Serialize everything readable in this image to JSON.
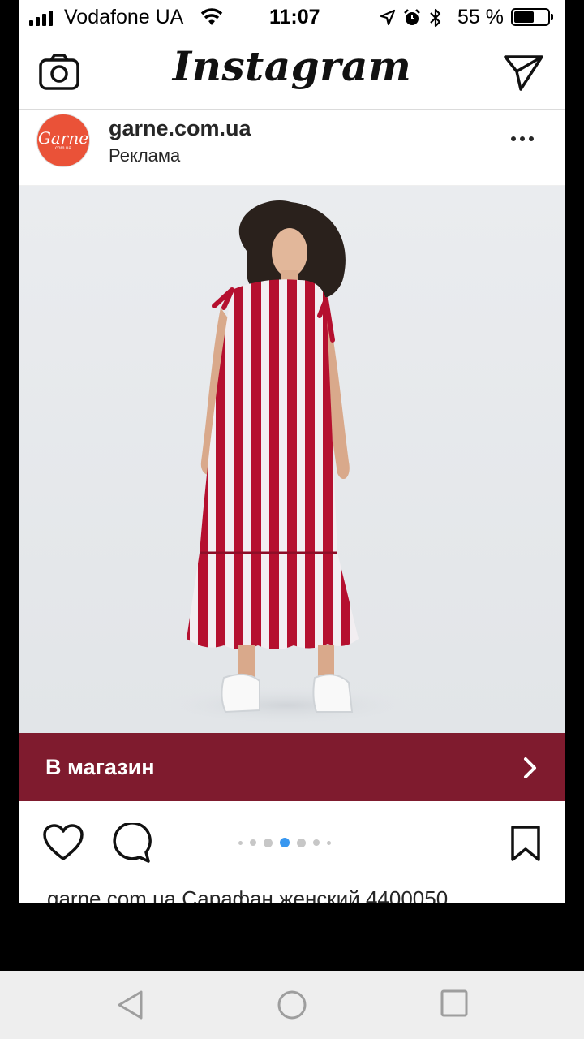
{
  "status_bar": {
    "carrier": "Vodafone UA",
    "time": "11:07",
    "battery_percent": "55 %",
    "battery_level": 0.55,
    "icons": [
      "signal-icon",
      "wifi-icon",
      "location-icon",
      "alarm-icon",
      "bluetooth-icon",
      "battery-icon"
    ]
  },
  "header": {
    "app_title": "Instagram",
    "left_icon": "camera-icon",
    "right_icon": "direct-message-icon"
  },
  "post": {
    "username": "garne.com.ua",
    "subtitle": "Реклама",
    "avatar": {
      "brand": "Garne",
      "sub": "com.ua"
    },
    "more_icon": "more-options-icon",
    "image": {
      "alt": "striped-dress-photo",
      "stripe_red": "#b5102f",
      "stripe_white": "#ffffff"
    },
    "cta": {
      "label": "В магазин",
      "color": "#7f1b2e"
    },
    "carousel": {
      "count": 7,
      "active": 4
    },
    "caption_partial": "garne.com.ua Сарафан женский 4400050"
  },
  "accent_color": "#3897f0",
  "system_nav": {
    "icons": [
      "back-icon",
      "home-icon",
      "recents-icon"
    ]
  }
}
